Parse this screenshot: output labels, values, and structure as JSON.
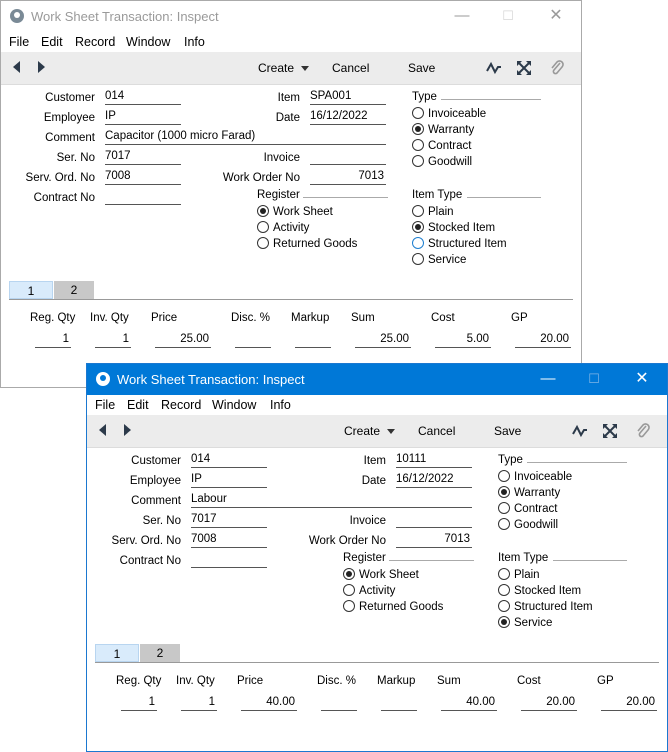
{
  "menu": [
    "File",
    "Edit",
    "Record",
    "Window",
    "Info"
  ],
  "toolbar": {
    "create": "Create",
    "cancel": "Cancel",
    "save": "Save"
  },
  "labels": {
    "customer": "Customer",
    "employee": "Employee",
    "comment": "Comment",
    "ser_no": "Ser. No",
    "serv_ord_no": "Serv. Ord. No",
    "contract_no": "Contract No",
    "item": "Item",
    "date": "Date",
    "invoice": "Invoice",
    "work_order_no": "Work Order No",
    "type": "Type",
    "register": "Register",
    "item_type": "Item Type"
  },
  "type_options": [
    "Invoiceable",
    "Warranty",
    "Contract",
    "Goodwill"
  ],
  "register_options": [
    "Work Sheet",
    "Activity",
    "Returned Goods"
  ],
  "item_type_options": [
    "Plain",
    "Stocked Item",
    "Structured Item",
    "Service"
  ],
  "tabs": [
    "1",
    "2"
  ],
  "columns": [
    "Reg. Qty",
    "Inv. Qty",
    "Price",
    "Disc. %",
    "Markup",
    "Sum",
    "Cost",
    "GP"
  ],
  "colors": {
    "active_titlebar": "#0078d7",
    "toolbar_bg": "#ececec",
    "active_tab": "#d9ebfb"
  },
  "windows": [
    {
      "title": "Work Sheet Transaction: Inspect",
      "active": false,
      "customer": "014",
      "employee": "IP",
      "comment": "Capacitor (1000 micro Farad)",
      "ser_no": "7017",
      "serv_ord_no": "7008",
      "contract_no": "",
      "item": "SPA001",
      "date": "16/12/2022",
      "invoice": "",
      "work_order_no": "7013",
      "type_selected": "Warranty",
      "register_selected": "Work Sheet",
      "item_type_selected": "Stocked Item",
      "row": {
        "reg_qty": "1",
        "inv_qty": "1",
        "price": "25.00",
        "disc": "",
        "markup": "",
        "sum": "25.00",
        "cost": "5.00",
        "gp": "20.00"
      }
    },
    {
      "title": "Work Sheet Transaction: Inspect",
      "active": true,
      "customer": "014",
      "employee": "IP",
      "comment": "Labour",
      "ser_no": "7017",
      "serv_ord_no": "7008",
      "contract_no": "",
      "item": "10111",
      "date": "16/12/2022",
      "invoice": "",
      "work_order_no": "7013",
      "type_selected": "Warranty",
      "register_selected": "Work Sheet",
      "item_type_selected": "Service",
      "row": {
        "reg_qty": "1",
        "inv_qty": "1",
        "price": "40.00",
        "disc": "",
        "markup": "",
        "sum": "40.00",
        "cost": "20.00",
        "gp": "20.00"
      }
    }
  ]
}
